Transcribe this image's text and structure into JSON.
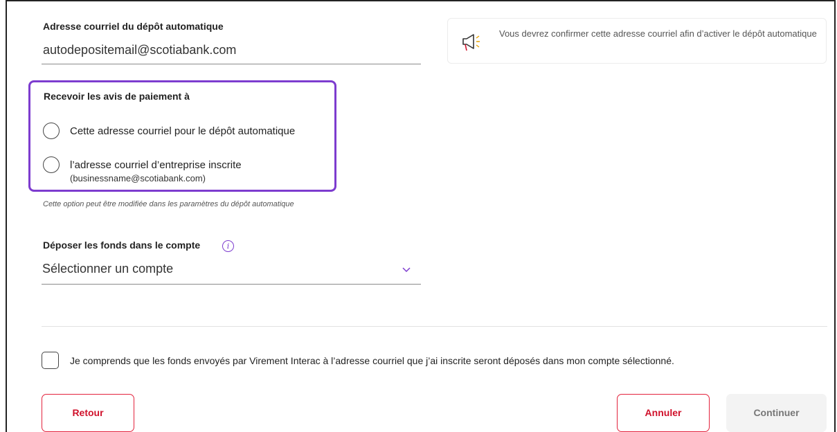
{
  "email_field": {
    "label": "Adresse courriel du dépôt automatique",
    "value": "autodepositemail@scotiabank.com"
  },
  "notice": {
    "icon": "megaphone-icon",
    "text": "Vous devrez confirmer cette adresse courriel afin d’activer le dépôt automatique"
  },
  "notifications": {
    "label": "Recevoir les avis de paiement à",
    "options": [
      {
        "label": "Cette adresse courriel pour le dépôt automatique",
        "sub": ""
      },
      {
        "label": "l’adresse courriel d’entreprise inscrite",
        "sub": "(businessname@scotiabank.com)"
      }
    ],
    "hint": "Cette option peut être modifiée dans les paramètres du dépôt automatique"
  },
  "deposit_account": {
    "label": "Déposer les fonds dans le compte",
    "info_icon": "i",
    "placeholder": "Sélectionner un compte"
  },
  "agreement": {
    "text": "Je comprends que les fonds envoyés par Virement Interac à l’adresse courriel que j’ai inscrite seront déposés dans mon compte sélectionné."
  },
  "buttons": {
    "back": "Retour",
    "cancel": "Annuler",
    "continue": "Continuer"
  },
  "colors": {
    "accent_purple": "#7d3ccf",
    "brand_red": "#d0112b"
  }
}
